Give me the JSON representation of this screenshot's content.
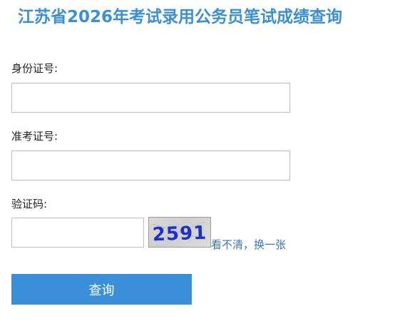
{
  "page": {
    "title": "江苏省2026年考试录用公务员笔试成绩查询"
  },
  "form": {
    "id_number": {
      "label": "身份证号:",
      "value": "",
      "placeholder": ""
    },
    "exam_number": {
      "label": "准考证号:",
      "value": "",
      "placeholder": ""
    },
    "captcha": {
      "label": "验证码:",
      "value": "",
      "placeholder": "",
      "image_text": "2591",
      "refresh_label": "看不清，换一张"
    },
    "submit_label": "查询"
  },
  "colors": {
    "title": "#3a8fd6",
    "button": "#3b8fd8",
    "link": "#3b73b9",
    "captcha_text": "#1e2fd0"
  }
}
